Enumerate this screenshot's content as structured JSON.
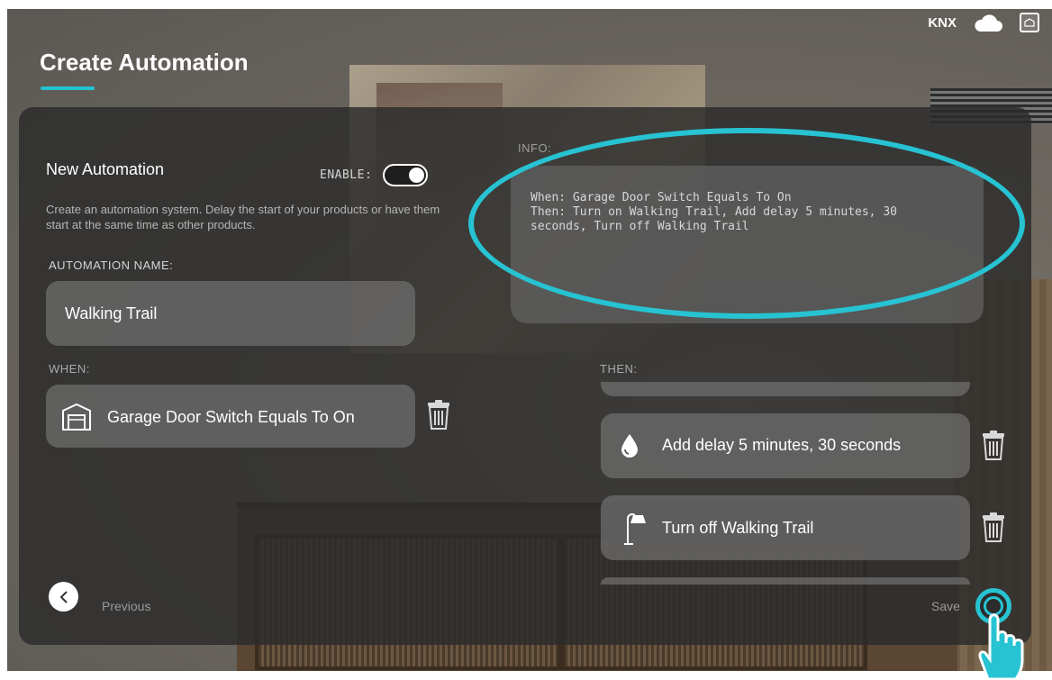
{
  "header": {
    "title": "Create Automation",
    "status_label": "KNX",
    "cloud_icon": "cloud-icon",
    "home_icon": "home-icon"
  },
  "automation": {
    "heading": "New Automation",
    "enable_label": "ENABLE:",
    "enabled": true,
    "description": "Create an automation system. Delay the start of your products or have them start at the same time as other products.",
    "name_label": "AUTOMATION NAME:",
    "name_value": "Walking Trail"
  },
  "info": {
    "label": "INFO:",
    "text": "When: Garage Door Switch Equals To On\nThen: Turn on Walking Trail, Add delay 5 minutes, 30 seconds, Turn off Walking Trail"
  },
  "when": {
    "label": "WHEN:",
    "items": [
      {
        "icon": "garage-icon",
        "label": "Garage Door Switch Equals To On"
      }
    ]
  },
  "then": {
    "label": "THEN:",
    "items": [
      {
        "icon": "drop-icon",
        "label": "Add delay 5 minutes, 30 seconds"
      },
      {
        "icon": "lamp-icon",
        "label": "Turn off Walking Trail"
      }
    ]
  },
  "footer": {
    "previous_label": "Previous",
    "save_label": "Save"
  },
  "colors": {
    "accent": "#27c3d2",
    "panel": "#2b2b2b"
  }
}
